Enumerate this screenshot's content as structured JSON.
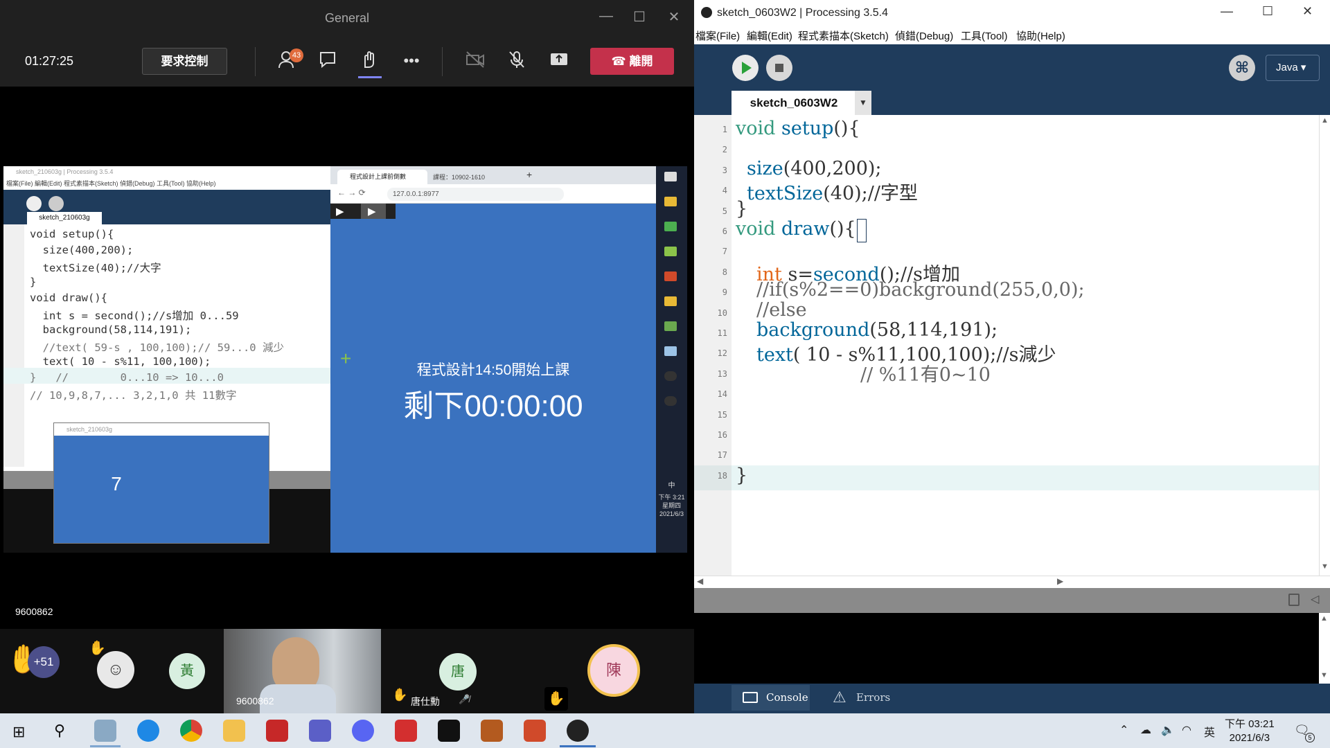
{
  "teams": {
    "window_title": "General",
    "timer": "01:27:25",
    "request_control": "要求控制",
    "participant_badge": "43",
    "leave": "離開",
    "presenter": "9600862",
    "gallery": {
      "raised_count": "+51",
      "avatar_huang": "黃",
      "avatar_tang": "唐",
      "tang_name": "唐仕勳",
      "video_name": "9600862",
      "avatar_chen": "陳"
    },
    "shared_screen": {
      "proc_title": "sketch_210603g | Processing 3.5.4",
      "proc_menu": "檔案(File) 編輯(Edit) 程式素描本(Sketch) 偵錯(Debug) 工具(Tool) 協助(Help)",
      "proc_tab": "sketch_210603g",
      "code_lines": [
        "void setup(){",
        "  size(400,200);",
        "  textSize(40);//大字",
        "}",
        "void draw(){",
        "  int s = second();//s增加 0...59",
        "  background(58,114,191);",
        "  //text( 59-s , 100,100);// 59...0 減少",
        "  text( 10 - s%11, 100,100);",
        "}   //        0...10 => 10...0",
        "// 10,9,8,7,... 3,2,1,0 共 11數字"
      ],
      "mini_title": "sketch_210603g",
      "mini_value": "7",
      "chrome_tab1": "程式設計上課前倒數",
      "chrome_tab2": "課程：10902-1610",
      "url": "127.0.0.1:8977",
      "countdown_title": "程式設計14:50開始上課",
      "countdown_time": "剩下00:00:00",
      "clock": [
        "下午 3:21",
        "星期四",
        "2021/6/3"
      ],
      "ime": "中"
    }
  },
  "pde": {
    "title": "sketch_0603W2 | Processing 3.5.4",
    "menu": [
      "檔案(File)",
      "編輯(Edit)",
      "程式素描本(Sketch)",
      "偵錯(Debug)",
      "工具(Tool)",
      "協助(Help)"
    ],
    "mode": "Java ▾",
    "tab": "sketch_0603W2",
    "line_numbers": [
      "1",
      "2",
      "3",
      "4",
      "5",
      "6",
      "7",
      "8",
      "9",
      "10",
      "11",
      "12",
      "13",
      "14",
      "15",
      "16",
      "17",
      "18"
    ],
    "code": {
      "l1a": "void",
      "l1b": "setup",
      "l1c": "(){",
      "l3a": "size",
      "l3b": "(400,200);",
      "l4a": "textSize",
      "l4b": "(40);//字型",
      "l5": "}",
      "l6a": "void",
      "l6b": "draw",
      "l6c": "(){",
      "l8a": "int",
      "l8b": " s=",
      "l8c": "second",
      "l8d": "();//s增加",
      "l9": "//if(s%2==0)background(255,0,0);",
      "l10": "//else",
      "l11a": "background",
      "l11b": "(58,114,191);",
      "l12a": "text",
      "l12b": "( 10 - s%11,100,100);//s減少",
      "l13": "// %11有0~10",
      "l15": "}"
    },
    "console_tab": "Console",
    "errors_tab": "Errors"
  },
  "taskbar": {
    "time": "下午 03:21",
    "date": "2021/6/3",
    "ime": "英",
    "notif": "5"
  },
  "colors": {
    "pde_bg": "#1f3c5c",
    "sketch_blue": "#3a72bf",
    "leave_red": "#c4314b"
  }
}
